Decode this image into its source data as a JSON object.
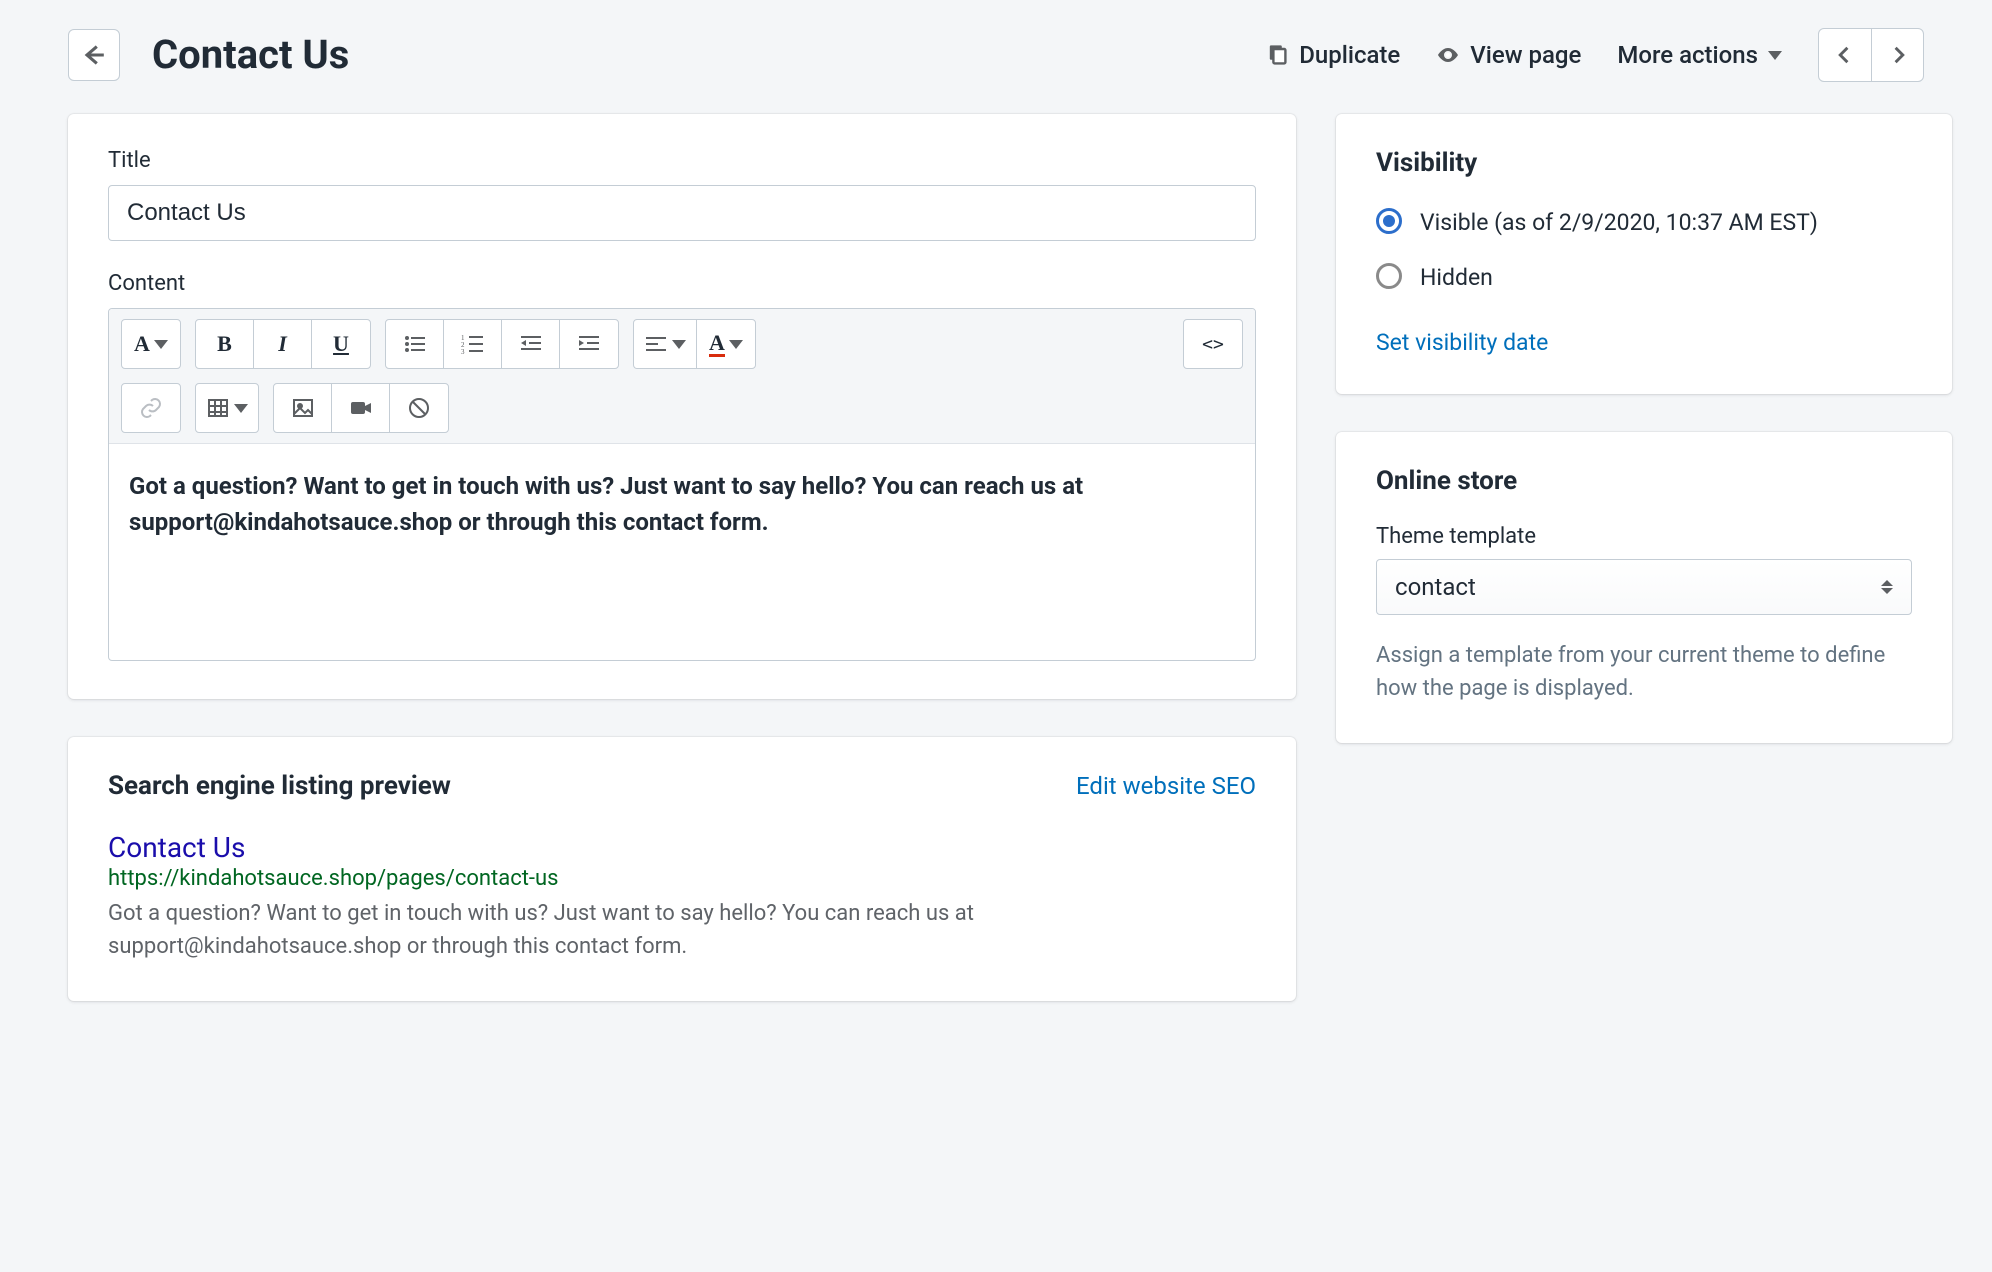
{
  "header": {
    "title": "Contact Us",
    "duplicate": "Duplicate",
    "view_page": "View page",
    "more_actions": "More actions"
  },
  "editor": {
    "title_label": "Title",
    "title_value": "Contact Us",
    "content_label": "Content",
    "content_body": "Got a question? Want to get in touch with us? Just want to say hello? You can reach us at support@kindahotsauce.shop or through this contact form.",
    "html_btn": "<>"
  },
  "seo": {
    "heading": "Search engine listing preview",
    "edit": "Edit website SEO",
    "title": "Contact Us",
    "url": "https://kindahotsauce.shop/pages/contact-us",
    "desc": "Got a question? Want to get in touch with us? Just want to say hello? You can reach us at support@kindahotsauce.shop or through this contact form."
  },
  "visibility": {
    "heading": "Visibility",
    "visible": "Visible (as of 2/9/2020, 10:37 AM EST)",
    "hidden": "Hidden",
    "set_date": "Set visibility date"
  },
  "online_store": {
    "heading": "Online store",
    "template_label": "Theme template",
    "template_value": "contact",
    "helper": "Assign a template from your current theme to define how the page is displayed."
  }
}
